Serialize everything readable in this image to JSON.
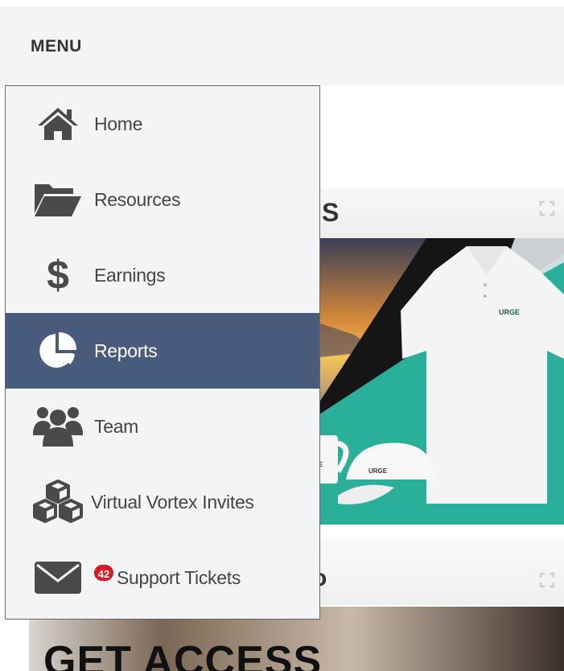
{
  "header": {
    "menu_label": "MENU"
  },
  "sidebar": {
    "items": [
      {
        "label": "Home",
        "icon": "home-icon",
        "active": false
      },
      {
        "label": "Resources",
        "icon": "folder-open-icon",
        "active": false
      },
      {
        "label": "Earnings",
        "icon": "dollar-icon",
        "active": false
      },
      {
        "label": "Reports",
        "icon": "pie-chart-icon",
        "active": true
      },
      {
        "label": "Team",
        "icon": "team-icon",
        "active": false
      },
      {
        "label": "Virtual Vortex Invites",
        "icon": "cubes-icon",
        "active": false
      },
      {
        "label": "Support Tickets",
        "icon": "envelope-icon",
        "active": false,
        "badge": "42"
      }
    ]
  },
  "background": {
    "panel1_title_fragment": "S",
    "panel2_title_fragment": "o",
    "shirt_logo_text": "URGE",
    "cap_logo_text": "URGE",
    "mug_logo_text": "RGE",
    "banner_text": "GET ACCESS"
  },
  "colors": {
    "active_bg": "#495b7c",
    "menu_bg": "#f3f4f6",
    "badge": "#d81b22",
    "promo_teal": "#2aaf9a"
  }
}
